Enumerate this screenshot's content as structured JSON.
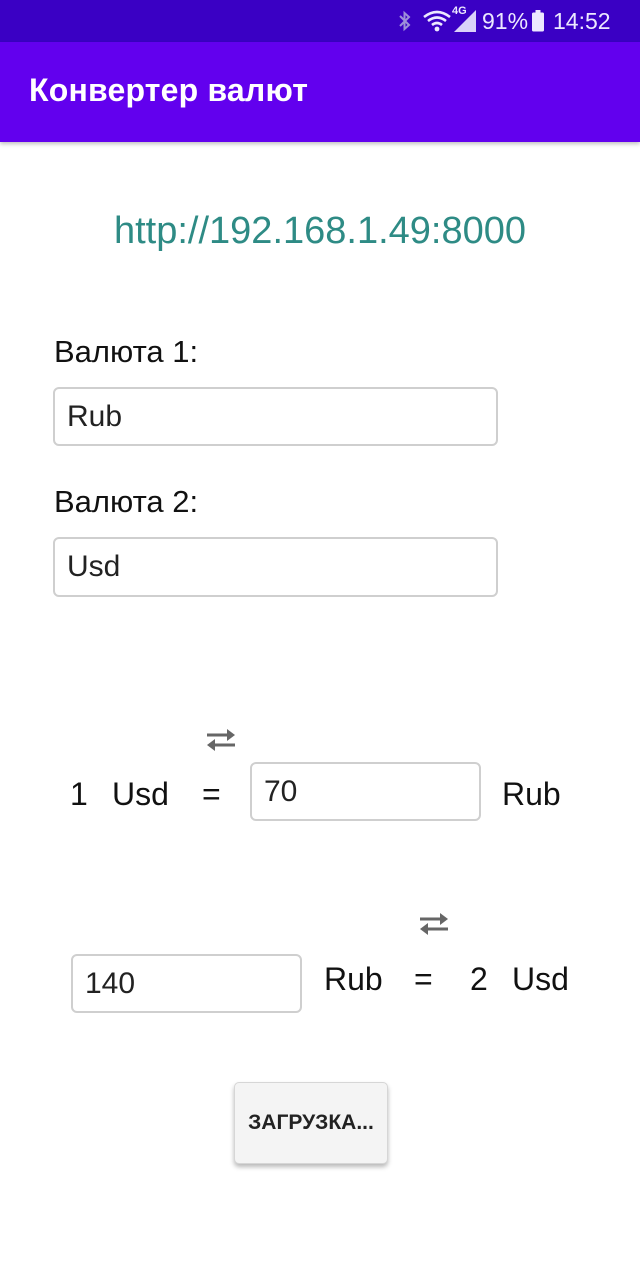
{
  "status_bar": {
    "battery_percent": "91%",
    "time": "14:52",
    "network_type": "4G",
    "icons": [
      "bluetooth-icon",
      "wifi-icon",
      "signal-icon",
      "battery-icon"
    ]
  },
  "app_bar": {
    "title": "Конвертер валют"
  },
  "server_url": "http://192.168.1.49:8000",
  "currency1": {
    "label": "Валюта 1:",
    "value": "Rub"
  },
  "currency2": {
    "label": "Валюта 2:",
    "value": "Usd"
  },
  "conversion1": {
    "amount": "1",
    "currency": "Usd",
    "equals": "=",
    "rate_value": "70",
    "result_currency": "Rub",
    "swap_icon": "swap-icon"
  },
  "conversion2": {
    "input_value": "140",
    "input_currency": "Rub",
    "equals": "=",
    "result_amount": "2",
    "result_currency": "Usd",
    "swap_icon": "swap-icon"
  },
  "load_button": {
    "label": "ЗАГРУЗКА..."
  },
  "colors": {
    "status_bar": "#3a00c4",
    "app_bar": "#6200ee",
    "url_text": "#2e8b85"
  }
}
